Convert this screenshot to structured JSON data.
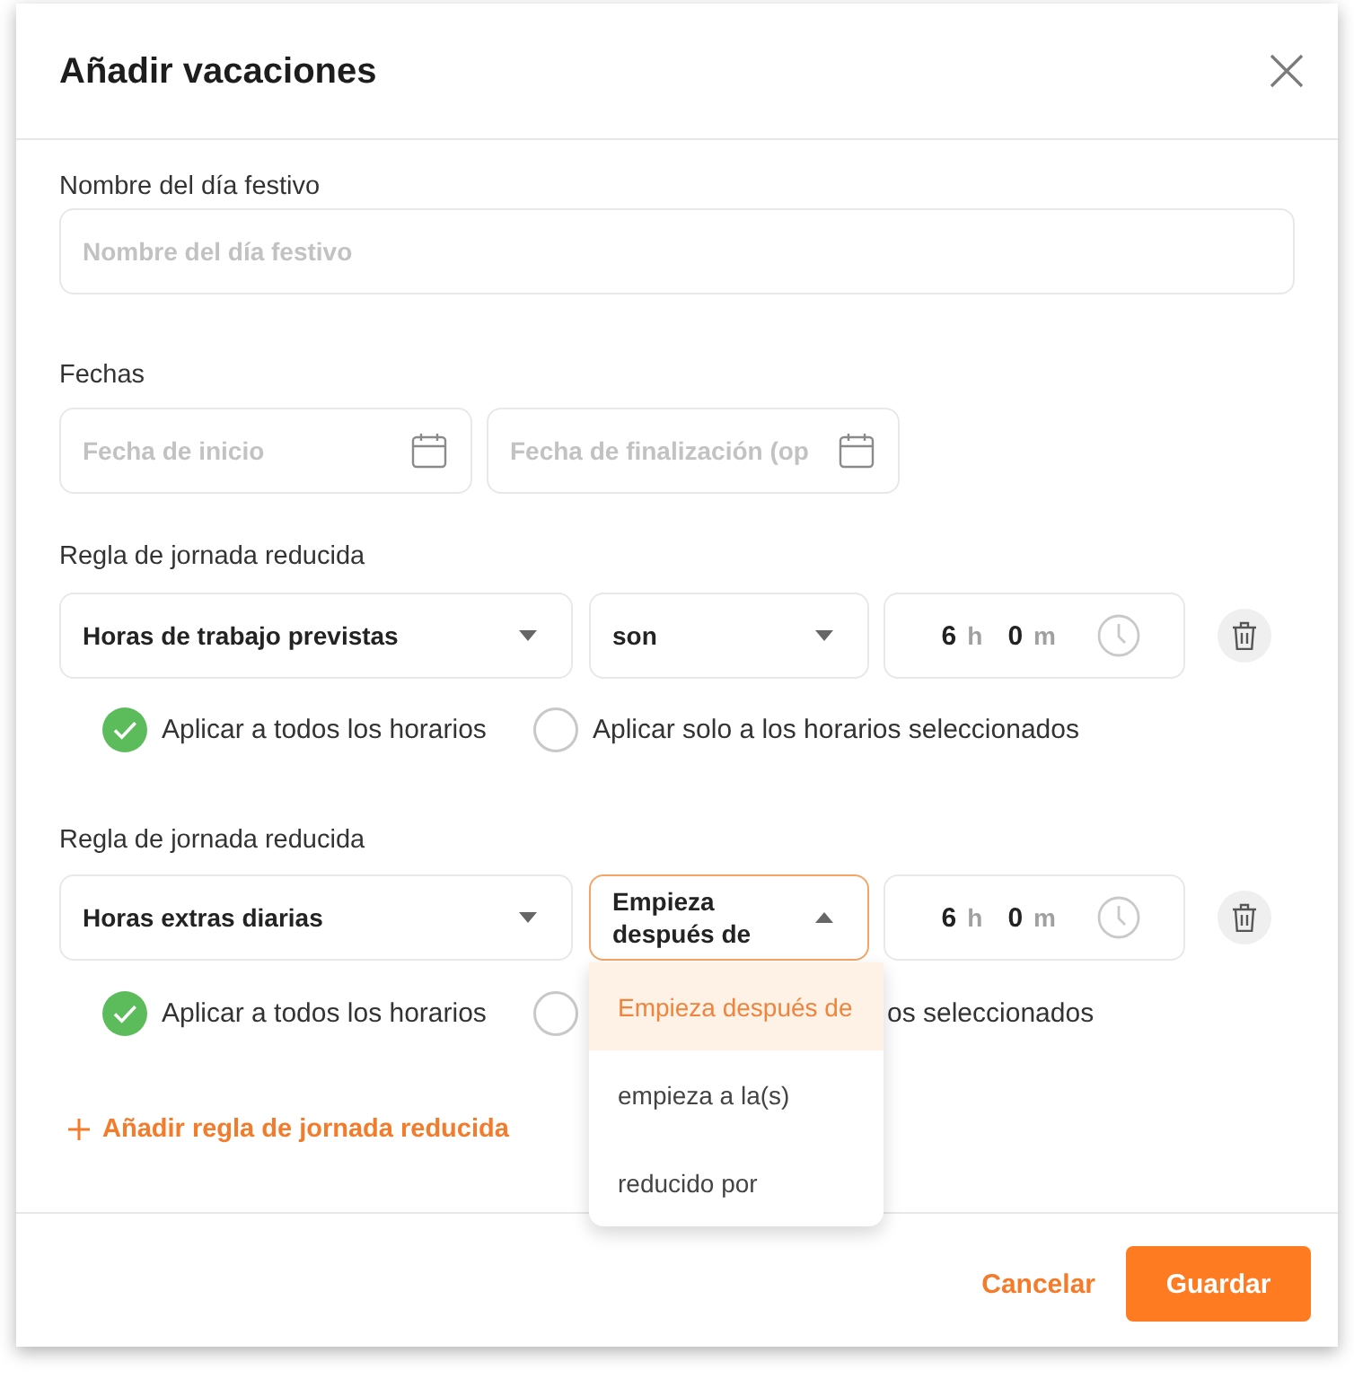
{
  "dialog": {
    "title": "Añadir vacaciones"
  },
  "name_field": {
    "label": "Nombre del día festivo",
    "placeholder": "Nombre del día festivo"
  },
  "dates": {
    "label": "Fechas",
    "fields": [
      {
        "placeholder": "Fecha de inicio"
      },
      {
        "placeholder": "Fecha de finalización (op"
      }
    ]
  },
  "rules": [
    {
      "label": "Regla de jornada reducida",
      "metric": {
        "value": "Horas de trabajo previstas",
        "expanded": false
      },
      "condition": {
        "value": "son",
        "expanded": false
      },
      "duration": {
        "hours": "6",
        "hours_unit": "h",
        "minutes": "0",
        "minutes_unit": "m"
      },
      "scope_options": [
        {
          "label": "Aplicar a todos los horarios",
          "selected": true
        },
        {
          "label": "Aplicar solo a los horarios seleccionados",
          "selected": false
        }
      ]
    },
    {
      "label": "Regla de jornada reducida",
      "metric": {
        "value": "Horas extras diarias",
        "expanded": false
      },
      "condition": {
        "value": "Empieza después de",
        "expanded": true,
        "options": [
          {
            "label": "Empieza después de",
            "selected": true
          },
          {
            "label": "empieza a la(s)",
            "selected": false
          },
          {
            "label": "reducido por",
            "selected": false
          }
        ]
      },
      "duration": {
        "hours": "6",
        "hours_unit": "h",
        "minutes": "0",
        "minutes_unit": "m"
      },
      "scope_options": [
        {
          "label": "Aplicar a todos los horarios",
          "selected": true
        },
        {
          "label": "os seleccionados",
          "selected": false
        }
      ]
    }
  ],
  "add_rule": {
    "label": "Añadir regla de jornada reducida"
  },
  "buttons": [
    {
      "label": "Cancelar",
      "kind": "text"
    },
    {
      "label": "Guardar",
      "kind": "primary"
    }
  ]
}
